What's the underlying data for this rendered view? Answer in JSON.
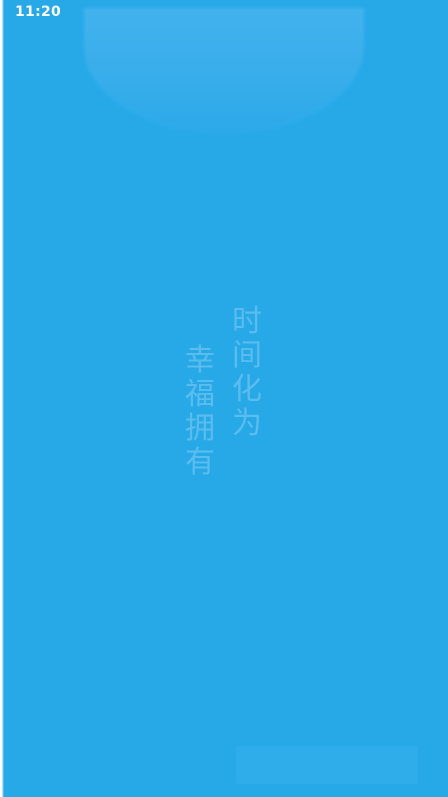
{
  "status_bar": {
    "time": "11:20"
  },
  "slogan": {
    "right_column": [
      "时",
      "间",
      "化",
      "为"
    ],
    "left_column": [
      "幸",
      "福",
      "拥",
      "有"
    ]
  },
  "colors": {
    "background": "#27a9e8",
    "slogan_text": "#5bbcee",
    "status_text": "#ffffff"
  }
}
